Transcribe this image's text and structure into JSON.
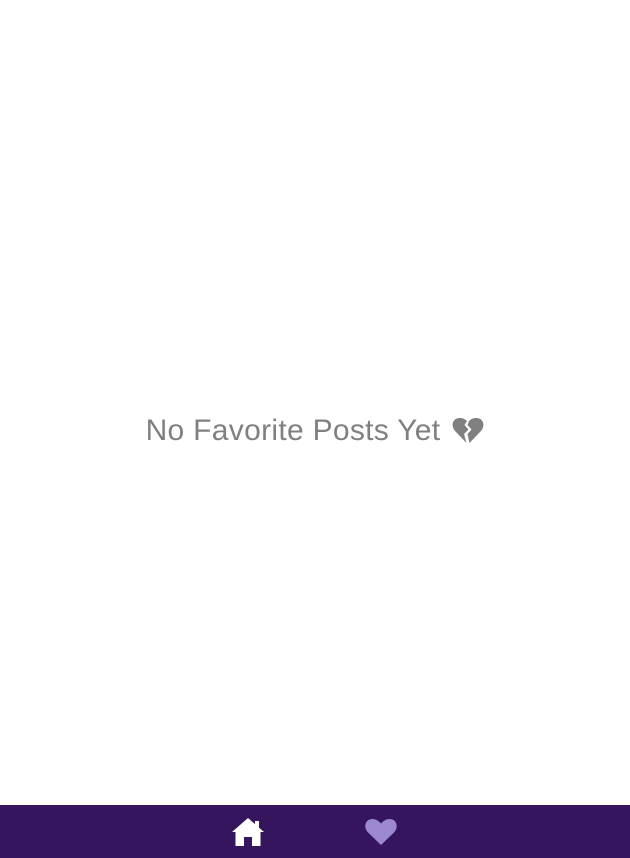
{
  "favorites": {
    "empty_message": "No Favorite Posts Yet",
    "empty_icon": "broken-heart-icon"
  },
  "bottom_nav": {
    "items": [
      {
        "name": "home",
        "icon": "home-icon",
        "active": false
      },
      {
        "name": "favorites",
        "icon": "heart-icon",
        "active": true
      }
    ]
  },
  "colors": {
    "nav_background": "#35155d",
    "home_icon": "#ffffff",
    "heart_icon_active": "#9c88d0",
    "empty_text": "#808080"
  }
}
